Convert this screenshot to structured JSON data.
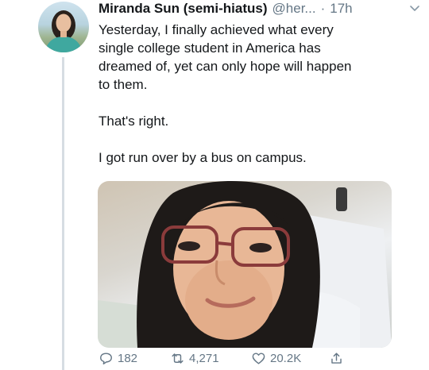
{
  "tweet": {
    "name": "Miranda Sun (semi-hiatus)",
    "handle": "@her...",
    "separator": "·",
    "time": "17h",
    "paragraphs": [
      "Yesterday, I finally achieved what every\nsingle college student in America has\ndreamed of, yet can only hope will happen\nto them.",
      "That's right.",
      "I got run over by a bus on campus."
    ],
    "photo_subject": "selfie-in-hospital-bed"
  },
  "actions": {
    "reply_count": "182",
    "retweet_count": "4,271",
    "like_count": "20.2K"
  },
  "colors": {
    "text": "#14171a",
    "muted": "#657786",
    "thread_line": "#d6dde3"
  }
}
